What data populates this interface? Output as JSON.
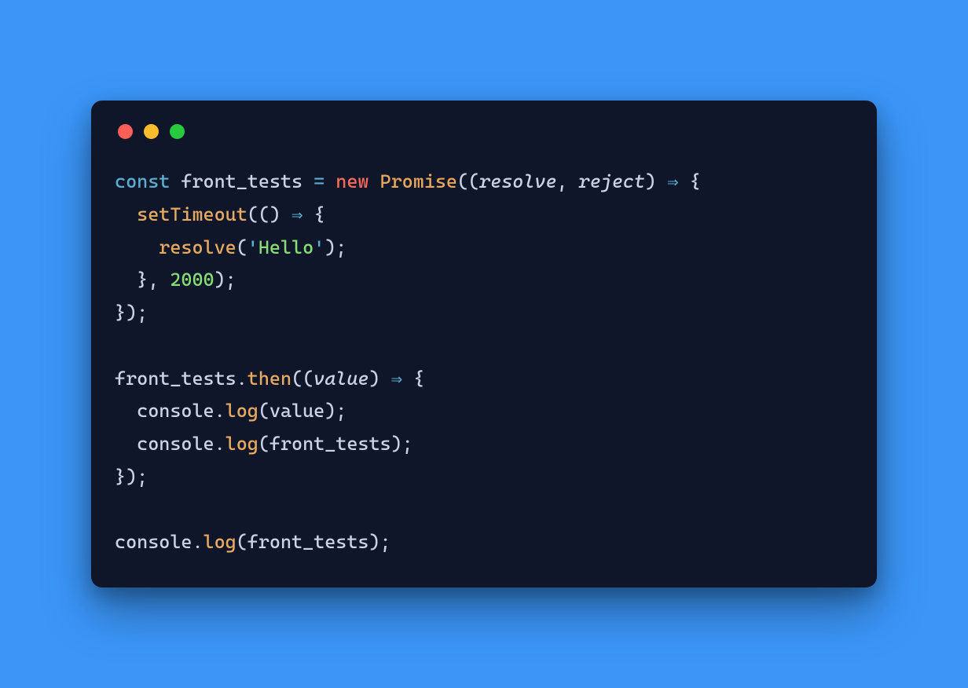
{
  "window": {
    "traffic_lights": [
      "close",
      "minimize",
      "maximize"
    ]
  },
  "code": {
    "tokens": [
      [
        {
          "t": "const ",
          "c": "tok-keyword"
        },
        {
          "t": "front_tests",
          "c": "tok-identifier"
        },
        {
          "t": " ",
          "c": "tok-punct"
        },
        {
          "t": "=",
          "c": "tok-operator"
        },
        {
          "t": " ",
          "c": "tok-punct"
        },
        {
          "t": "new",
          "c": "tok-new"
        },
        {
          "t": " ",
          "c": "tok-punct"
        },
        {
          "t": "Promise",
          "c": "tok-class"
        },
        {
          "t": "((",
          "c": "tok-punct"
        },
        {
          "t": "resolve",
          "c": "tok-param"
        },
        {
          "t": ", ",
          "c": "tok-punct"
        },
        {
          "t": "reject",
          "c": "tok-param"
        },
        {
          "t": ") ",
          "c": "tok-punct"
        },
        {
          "t": "⇒",
          "c": "tok-operator"
        },
        {
          "t": " {",
          "c": "tok-punct"
        }
      ],
      [
        {
          "t": "  ",
          "c": "tok-punct"
        },
        {
          "t": "setTimeout",
          "c": "tok-call"
        },
        {
          "t": "(() ",
          "c": "tok-punct"
        },
        {
          "t": "⇒",
          "c": "tok-operator"
        },
        {
          "t": " {",
          "c": "tok-punct"
        }
      ],
      [
        {
          "t": "    ",
          "c": "tok-punct"
        },
        {
          "t": "resolve",
          "c": "tok-call"
        },
        {
          "t": "(",
          "c": "tok-punct"
        },
        {
          "t": "'",
          "c": "tok-string-quote"
        },
        {
          "t": "Hello",
          "c": "tok-string"
        },
        {
          "t": "'",
          "c": "tok-string-quote"
        },
        {
          "t": ");",
          "c": "tok-punct"
        }
      ],
      [
        {
          "t": "  }, ",
          "c": "tok-punct"
        },
        {
          "t": "2000",
          "c": "tok-number"
        },
        {
          "t": ");",
          "c": "tok-punct"
        }
      ],
      [
        {
          "t": "});",
          "c": "tok-punct"
        }
      ],
      [
        {
          "t": "",
          "c": "tok-punct"
        }
      ],
      [
        {
          "t": "front_tests",
          "c": "tok-prop"
        },
        {
          "t": ".",
          "c": "tok-punct"
        },
        {
          "t": "then",
          "c": "tok-call"
        },
        {
          "t": "((",
          "c": "tok-punct"
        },
        {
          "t": "value",
          "c": "tok-param"
        },
        {
          "t": ") ",
          "c": "tok-punct"
        },
        {
          "t": "⇒",
          "c": "tok-operator"
        },
        {
          "t": " {",
          "c": "tok-punct"
        }
      ],
      [
        {
          "t": "  console",
          "c": "tok-prop"
        },
        {
          "t": ".",
          "c": "tok-punct"
        },
        {
          "t": "log",
          "c": "tok-call"
        },
        {
          "t": "(",
          "c": "tok-punct"
        },
        {
          "t": "value",
          "c": "tok-prop"
        },
        {
          "t": ");",
          "c": "tok-punct"
        }
      ],
      [
        {
          "t": "  console",
          "c": "tok-prop"
        },
        {
          "t": ".",
          "c": "tok-punct"
        },
        {
          "t": "log",
          "c": "tok-call"
        },
        {
          "t": "(",
          "c": "tok-punct"
        },
        {
          "t": "front_tests",
          "c": "tok-prop"
        },
        {
          "t": ");",
          "c": "tok-punct"
        }
      ],
      [
        {
          "t": "});",
          "c": "tok-punct"
        }
      ],
      [
        {
          "t": "",
          "c": "tok-punct"
        }
      ],
      [
        {
          "t": "console",
          "c": "tok-prop"
        },
        {
          "t": ".",
          "c": "tok-punct"
        },
        {
          "t": "log",
          "c": "tok-call"
        },
        {
          "t": "(",
          "c": "tok-punct"
        },
        {
          "t": "front_tests",
          "c": "tok-prop"
        },
        {
          "t": ");",
          "c": "tok-punct"
        }
      ]
    ]
  }
}
